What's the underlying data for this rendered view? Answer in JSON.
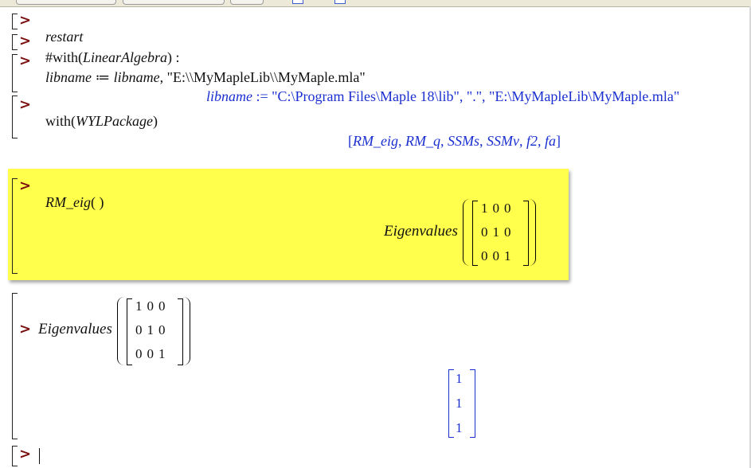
{
  "worksheet": {
    "groups": [
      {
        "input_parts": [
          {
            "t": "restart",
            "s": "it"
          }
        ]
      },
      {
        "input_parts": [
          {
            "t": "#with(",
            "s": "up"
          },
          {
            "t": "LinearAlgebra",
            "s": "it"
          },
          {
            "t": ") :",
            "s": "up"
          }
        ]
      },
      {
        "input_parts": [
          {
            "t": "libname",
            "s": "it"
          },
          {
            "t": " ≔ ",
            "s": "up"
          },
          {
            "t": "libname",
            "s": "it"
          },
          {
            "t": ", \"E:\\\\MyMapleLib\\\\MyMaple.mla\"",
            "s": "up"
          }
        ],
        "output_parts": [
          {
            "t": "libname",
            "s": "it"
          },
          {
            "t": " := \"C:\\Program Files\\Maple 18\\lib\", \".\", \"E:\\MyMapleLib\\MyMaple.mla\"",
            "s": "up"
          }
        ]
      },
      {
        "input_parts": [
          {
            "t": "with(",
            "s": "up"
          },
          {
            "t": "WYLPackage",
            "s": "it"
          },
          {
            "t": ")",
            "s": "up"
          }
        ],
        "output_parts": [
          {
            "t": "[",
            "s": "up"
          },
          {
            "t": "RM_eig",
            "s": "it"
          },
          {
            "t": ", ",
            "s": "up"
          },
          {
            "t": "RM_q",
            "s": "it"
          },
          {
            "t": ", ",
            "s": "up"
          },
          {
            "t": "SSMs",
            "s": "it"
          },
          {
            "t": ", ",
            "s": "up"
          },
          {
            "t": "SSMv",
            "s": "it"
          },
          {
            "t": ", ",
            "s": "up"
          },
          {
            "t": "f2",
            "s": "it"
          },
          {
            "t": ", ",
            "s": "up"
          },
          {
            "t": "fa",
            "s": "it"
          },
          {
            "t": "]",
            "s": "up"
          }
        ]
      },
      {
        "input_parts": [
          {
            "t": "RM_eig",
            "s": "it"
          },
          {
            "t": "( )",
            "s": "up"
          }
        ]
      }
    ],
    "prompt": ">",
    "highlighted_output": {
      "label": "Eigenvalues",
      "matrix": [
        [
          "1",
          "0",
          "0"
        ],
        [
          "0",
          "1",
          "0"
        ],
        [
          "0",
          "0",
          "1"
        ]
      ]
    },
    "last_input": {
      "label": "Eigenvalues",
      "matrix": [
        [
          "1",
          "0",
          "0"
        ],
        [
          "0",
          "1",
          "0"
        ],
        [
          "0",
          "0",
          "1"
        ]
      ]
    },
    "last_output": {
      "vector": [
        "1",
        "1",
        "1"
      ]
    },
    "highlight_color": "#ffff4c",
    "prompt_color": "#7a1010",
    "output_color": "#1a2fd0"
  }
}
